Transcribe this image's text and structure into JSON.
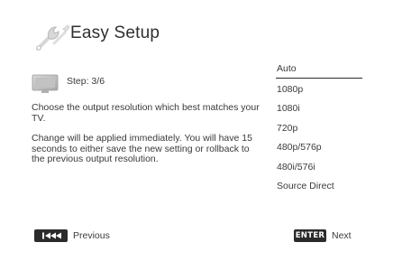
{
  "header": {
    "title": "Easy Setup",
    "icon": "wrench-icon"
  },
  "step": {
    "label": "Step: 3/6",
    "icon": "display-icon"
  },
  "description": {
    "paragraph1": "Choose the output resolution which best matches your TV.",
    "paragraph2": "Change will be applied immediately.  You will have 15 seconds to either save the new setting or rollback to the previous output resolution."
  },
  "resolution_options": {
    "selected": "Auto",
    "items": [
      "Auto",
      "1080p",
      "1080i",
      "720p",
      "480p/576p",
      "480i/576i",
      "Source Direct"
    ]
  },
  "footer": {
    "previous": {
      "key_icon": "skip-back-icon",
      "label": "Previous"
    },
    "next": {
      "key_label": "ENTER",
      "label": "Next"
    }
  },
  "colors": {
    "text": "#3a3a3a",
    "key_background": "#2b2b2b",
    "background": "#ffffff"
  }
}
